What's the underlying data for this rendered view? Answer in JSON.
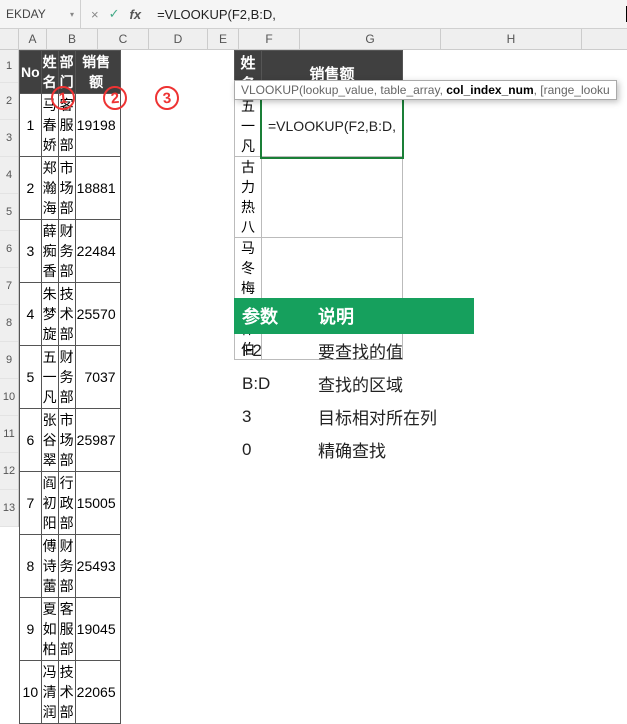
{
  "formula_bar": {
    "name_box": "EKDAY",
    "cancel_icon": "×",
    "confirm_icon": "✓",
    "fx_label": "fx",
    "formula": "=VLOOKUP(F2,B:D,"
  },
  "tooltip": {
    "fn": "VLOOKUP(",
    "p1": "lookup_value",
    "p2": "table_array",
    "p3": "col_index_num",
    "p4": "[range_looku"
  },
  "col_letters": [
    "A",
    "B",
    "C",
    "D",
    "E",
    "F",
    "G",
    "H"
  ],
  "row_numbers": [
    "1",
    "2",
    "3",
    "4",
    "5",
    "6",
    "7",
    "8",
    "9",
    "10",
    "11",
    "12",
    "13"
  ],
  "left": {
    "headers": [
      "No",
      "姓名",
      "部门",
      "销售额"
    ],
    "rows": [
      {
        "no": "1",
        "name": "马春娇",
        "dept": "客服部",
        "sales": "19198"
      },
      {
        "no": "2",
        "name": "郑瀚海",
        "dept": "市场部",
        "sales": "18881"
      },
      {
        "no": "3",
        "name": "薛痴香",
        "dept": "财务部",
        "sales": "22484"
      },
      {
        "no": "4",
        "name": "朱梦旋",
        "dept": "技术部",
        "sales": "25570"
      },
      {
        "no": "5",
        "name": "五一凡",
        "dept": "财务部",
        "sales": "7037"
      },
      {
        "no": "6",
        "name": "张谷翠",
        "dept": "市场部",
        "sales": "25987"
      },
      {
        "no": "7",
        "name": "阎初阳",
        "dept": "行政部",
        "sales": "15005"
      },
      {
        "no": "8",
        "name": "傅诗蕾",
        "dept": "财务部",
        "sales": "25493"
      },
      {
        "no": "9",
        "name": "夏如柏",
        "dept": "客服部",
        "sales": "19045"
      },
      {
        "no": "10",
        "name": "冯清润",
        "dept": "技术部",
        "sales": "22065"
      }
    ],
    "circles": [
      "1",
      "2",
      "3"
    ]
  },
  "right": {
    "headers": [
      "姓名",
      "销售额"
    ],
    "rows": [
      {
        "name": "五一凡",
        "sales": "=VLOOKUP(F2,B:D,"
      },
      {
        "name": "古力热八",
        "sales": ""
      },
      {
        "name": "马冬梅",
        "sales": ""
      },
      {
        "name": "番伟伯",
        "sales": ""
      }
    ]
  },
  "explain": {
    "headers": [
      "参数",
      "说明"
    ],
    "rows": [
      {
        "p": "F2",
        "d": "要查找的值"
      },
      {
        "p": "B:D",
        "d": "查找的区域"
      },
      {
        "p": "3",
        "d": "目标相对所在列"
      },
      {
        "p": "0",
        "d": "精确查找"
      }
    ]
  }
}
